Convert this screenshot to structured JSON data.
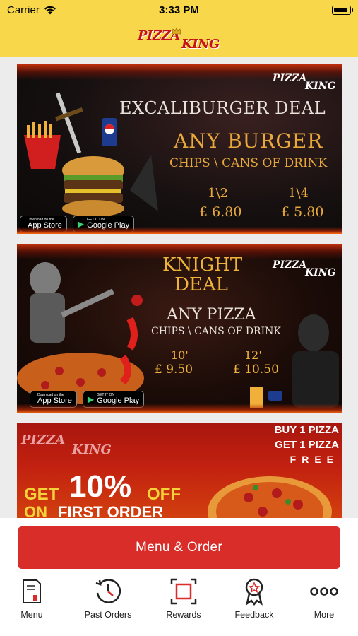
{
  "status_bar": {
    "carrier": "Carrier",
    "time": "3:33 PM"
  },
  "header": {
    "logo_line1": "PIZZA",
    "logo_line2": "KING"
  },
  "banners": [
    {
      "logo_a": "PIZZA",
      "logo_b": "KING",
      "title": "EXCALIBURGER DEAL",
      "headline": "ANY BURGER",
      "subline": "CHIPS \\ CANS OF DRINK",
      "option1_size": "1\\2",
      "option1_price": "£ 6.80",
      "option2_size": "1\\4",
      "option2_price": "£ 5.80",
      "appstore_small": "Download on the",
      "appstore_big": "App Store",
      "gplay_small": "GET IT ON",
      "gplay_big": "Google Play"
    },
    {
      "logo_a": "PIZZA",
      "logo_b": "KING",
      "title_line1": "KNIGHT",
      "title_line2": "DEAL",
      "headline": "ANY PIZZA",
      "subline": "CHIPS \\ CANS OF DRINK",
      "option1_size": "10'",
      "option1_price": "£ 9.50",
      "option2_size": "12'",
      "option2_price": "£ 10.50",
      "appstore_small": "Download on the",
      "appstore_big": "App Store",
      "gplay_small": "GET IT ON",
      "gplay_big": "Google Play"
    },
    {
      "logo_a": "PIZZA",
      "logo_b": "KING",
      "buy": "BUY 1 PIZZA",
      "get": "GET 1 PIZZA",
      "free": "FREE",
      "get_word": "GET",
      "discount": "10%",
      "off": "OFF",
      "on_word": "ON",
      "first_order": "FIRST ORDER"
    }
  ],
  "cta": {
    "label": "Menu & Order"
  },
  "tabbar": [
    {
      "label": "Menu",
      "icon": "menu-booklet-icon"
    },
    {
      "label": "Past Orders",
      "icon": "history-clock-icon"
    },
    {
      "label": "Rewards",
      "icon": "rewards-square-icon"
    },
    {
      "label": "Feedback",
      "icon": "feedback-rosette-icon"
    },
    {
      "label": "More",
      "icon": "more-dots-icon"
    }
  ],
  "colors": {
    "header_bg": "#f8d84a",
    "cta_bg": "#d92d2a",
    "accent_gold": "#e8a93a"
  }
}
